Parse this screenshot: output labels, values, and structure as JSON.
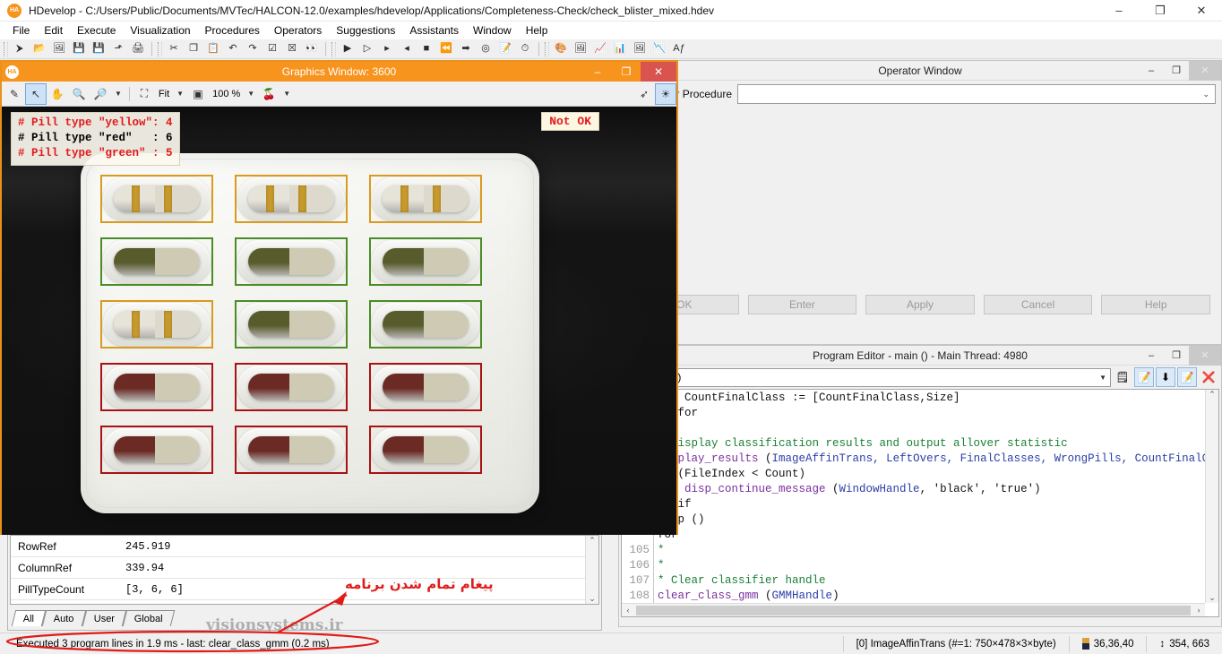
{
  "window": {
    "title": "HDevelop - C:/Users/Public/Documents/MVTec/HALCON-12.0/examples/hdevelop/Applications/Completeness-Check/check_blister_mixed.hdev",
    "logo": "HA",
    "minimize": "–",
    "maximize": "❐",
    "close": "✕"
  },
  "menu": {
    "items": [
      "File",
      "Edit",
      "Execute",
      "Visualization",
      "Procedures",
      "Operators",
      "Suggestions",
      "Assistants",
      "Window",
      "Help"
    ]
  },
  "toolbar": {
    "groups": [
      {
        "buttons": [
          {
            "name": "new-program-icon",
            "glyph": "⮞"
          },
          {
            "name": "open-program-icon",
            "glyph": "📂"
          },
          {
            "name": "open-recent-icon",
            "glyph": "🖼"
          },
          {
            "name": "save-program-icon",
            "glyph": "💾"
          },
          {
            "name": "save-as-icon",
            "glyph": "💾"
          },
          {
            "name": "export-icon",
            "glyph": "⬏"
          },
          {
            "name": "print-icon",
            "glyph": "🖨"
          }
        ]
      },
      {
        "buttons": [
          {
            "name": "cut-icon",
            "glyph": "✂"
          },
          {
            "name": "copy-icon",
            "glyph": "❐"
          },
          {
            "name": "paste-icon",
            "glyph": "📋"
          },
          {
            "name": "undo-icon",
            "glyph": "↶"
          },
          {
            "name": "redo-icon",
            "glyph": "↷"
          },
          {
            "name": "activate-line-icon",
            "glyph": "☑"
          },
          {
            "name": "deactivate-line-icon",
            "glyph": "☒"
          },
          {
            "name": "find-icon",
            "glyph": "👀"
          }
        ]
      },
      {
        "buttons": [
          {
            "name": "run-icon",
            "glyph": "▶"
          },
          {
            "name": "step-over-icon",
            "glyph": "▷"
          },
          {
            "name": "step-into-icon",
            "glyph": "▸"
          },
          {
            "name": "step-out-icon",
            "glyph": "◂"
          },
          {
            "name": "stop-icon",
            "glyph": "■"
          },
          {
            "name": "reset-program-icon",
            "glyph": "⏪"
          },
          {
            "name": "continue-icon",
            "glyph": "➡"
          },
          {
            "name": "insert-breakpoint-icon",
            "glyph": "◎"
          },
          {
            "name": "edit-procedure-icon",
            "glyph": "📝"
          },
          {
            "name": "timing-icon",
            "glyph": "⏱"
          }
        ]
      },
      {
        "buttons": [
          {
            "name": "palette-icon",
            "glyph": "🎨"
          },
          {
            "name": "image-viewer-icon",
            "glyph": "🖼"
          },
          {
            "name": "gray-histogram-icon",
            "glyph": "📈"
          },
          {
            "name": "histogram-icon",
            "glyph": "📊"
          },
          {
            "name": "image-info-icon",
            "glyph": "🖼"
          },
          {
            "name": "feature-histogram-icon",
            "glyph": "📉"
          },
          {
            "name": "font-icon",
            "glyph": "Aƒ"
          }
        ]
      }
    ]
  },
  "graphics_window": {
    "title": "Graphics Window: 3600",
    "logo": "HA",
    "minimize": "–",
    "maximize": "❐",
    "close": "✕",
    "toolbar": {
      "draw_mode_icon": "✎",
      "select_icon": "↖",
      "pan_icon": "✋",
      "zoom_icon": "🔍",
      "zoom_in_icon": "🔎",
      "fit_icon": "⛶",
      "fit_label": "Fit",
      "zoom_level_icon": "▣",
      "zoom_level": "100 %",
      "colors_icon": "🍒",
      "caret": "▼",
      "axes_icon": "➶",
      "lighting_icon": "☀"
    },
    "overlay": {
      "lines": [
        {
          "text": "# Pill type \"yellow\": 4",
          "color": "red"
        },
        {
          "text": "# Pill type \"red\"   : 6",
          "color": "black"
        },
        {
          "text": "# Pill type \"green\" : 5",
          "color": "red"
        }
      ],
      "status_badge": "Not OK",
      "status_badge_color": "#e01b1b"
    },
    "pill_grid": {
      "rows": [
        {
          "box_color": "#d99a1f",
          "pill_type": "yellow",
          "cells": [
            "yellow",
            "yellow",
            "yellow"
          ]
        },
        {
          "box_color": "#4a8c26",
          "pill_type": "green",
          "cells": [
            "green",
            "green",
            "green"
          ]
        },
        {
          "box_color_mixed": [
            "#d99a1f",
            "#4a8c26",
            "#4a8c26"
          ],
          "pill_type": "mixed",
          "cells": [
            "yellow",
            "green",
            "green"
          ]
        },
        {
          "box_color": "#a81212",
          "pill_type": "red",
          "cells": [
            "red",
            "red",
            "red"
          ]
        },
        {
          "box_color": "#a81212",
          "pill_type": "red",
          "cells": [
            "red",
            "red",
            "red"
          ]
        }
      ]
    }
  },
  "operator_window": {
    "title": "Operator Window",
    "minimize": "–",
    "maximize": "❐",
    "close": "✕",
    "field_label": "Operator or Procedure",
    "field_value": "",
    "caret": "⌄",
    "buttons": [
      "OK",
      "Enter",
      "Apply",
      "Cancel",
      "Help"
    ]
  },
  "program_editor": {
    "title": "Program Editor - main () - Main Thread: 4980",
    "minimize": "–",
    "maximize": "❐",
    "close": "✕",
    "procedure_icon": "⬏",
    "procedure_selected": "main (:::)",
    "caret": "▼",
    "toolbar_buttons": [
      {
        "name": "insert-operator-icon",
        "glyph": "🗒"
      },
      {
        "name": "check-syntax-icon",
        "glyph": "📝"
      },
      {
        "name": "download-procedure-icon",
        "glyph": "⬇"
      },
      {
        "name": "edit-procedure-icon",
        "glyph": "📝"
      },
      {
        "name": "delete-procedure-icon",
        "glyph": "❌"
      }
    ],
    "code_top": [
      {
        "num": "",
        "indent": 4,
        "parts": [
          {
            "t": "CountFinalClass := [CountFinalClass,Size]",
            "c": "kw"
          }
        ]
      },
      {
        "num": "",
        "indent": 0,
        "parts": [
          {
            "t": "endfor",
            "c": "kw"
          }
        ]
      },
      {
        "num": "",
        "indent": 0,
        "parts": [
          {
            "t": "*",
            "c": "cm"
          }
        ]
      },
      {
        "num": "",
        "indent": 0,
        "parts": [
          {
            "t": "* Display classification results and output allover statistic",
            "c": "cm"
          }
        ]
      },
      {
        "num": "",
        "indent": 0,
        "parts": [
          {
            "t": "display_results",
            "c": "fn"
          },
          {
            "t": " (",
            "c": "kw"
          },
          {
            "t": "ImageAffinTrans, LeftOvers, FinalClasses, WrongPills, CountFinalCl",
            "c": "var"
          }
        ]
      },
      {
        "num": "",
        "indent": 0,
        "parts": [
          {
            "t": "if (FileIndex < Count)",
            "c": "kw"
          }
        ]
      },
      {
        "num": "",
        "indent": 4,
        "parts": [
          {
            "t": "disp_continue_message",
            "c": "fn"
          },
          {
            "t": " (",
            "c": "kw"
          },
          {
            "t": "WindowHandle",
            "c": "var"
          },
          {
            "t": ", 'black', 'true')",
            "c": "kw"
          }
        ]
      },
      {
        "num": "",
        "indent": 0,
        "parts": [
          {
            "t": "endif",
            "c": "kw"
          }
        ]
      },
      {
        "num": "",
        "indent": 0,
        "parts": [
          {
            "t": "stop ()",
            "c": "kw"
          }
        ]
      },
      {
        "num": "",
        "indent": 0,
        "parts": [
          {
            "t": "for",
            "c": "kw"
          }
        ]
      }
    ],
    "code_bottom": [
      {
        "num": "105",
        "indent": 0,
        "parts": [
          {
            "t": "*",
            "c": "cm"
          }
        ]
      },
      {
        "num": "106",
        "indent": 0,
        "parts": [
          {
            "t": "*",
            "c": "cm"
          }
        ]
      },
      {
        "num": "107",
        "indent": 0,
        "parts": [
          {
            "t": "* Clear classifier handle",
            "c": "cm"
          }
        ]
      },
      {
        "num": "108",
        "indent": 0,
        "parts": [
          {
            "t": "clear_class_gmm",
            "c": "fn"
          },
          {
            "t": " (",
            "c": "kw"
          },
          {
            "t": "GMMHandle",
            "c": "var"
          },
          {
            "t": ")",
            "c": "kw"
          }
        ]
      },
      {
        "num": "➜",
        "indent": 0,
        "parts": [
          {
            "t": "",
            "c": "kw"
          }
        ]
      }
    ],
    "scroll_up": "⌃",
    "scroll_down": "⌄",
    "scroll_left": "‹",
    "scroll_right": "›"
  },
  "variable_window": {
    "rows": [
      {
        "name": "RowRef",
        "value": "245.919"
      },
      {
        "name": "ColumnRef",
        "value": "339.94"
      },
      {
        "name": "PillTypeCount",
        "value": "[3, 6, 6]"
      }
    ],
    "scroll_up": "⌃",
    "scroll_down": "⌄",
    "tabs": [
      "All",
      "Auto",
      "User",
      "Global"
    ],
    "active_tab": "All"
  },
  "statusbar": {
    "message": "Executed 3 program lines in 1.9 ms - last: clear_class_gmm (0.2 ms)",
    "image_info": "[0] ImageAffinTrans (#=1: 750×478×3×byte)",
    "pixel_value": "36,36,40",
    "coord_icon": "↕",
    "coordinates": "354, 663"
  },
  "annotations": {
    "persian_note": "پیغام تمام شدن برنامه",
    "accent_color": "#e01b1b",
    "watermark": "visionsystems.ir"
  }
}
